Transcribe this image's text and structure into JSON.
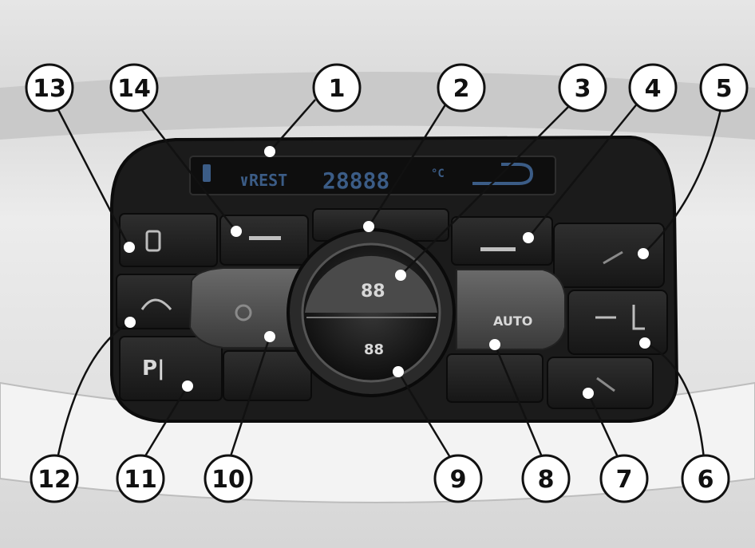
{
  "display": {
    "mode_text": "∨REST",
    "temp_text": "28888",
    "unit_text": "°C"
  },
  "buttons": {
    "parking": "P|",
    "auto": "AUTO",
    "upper_digits": "88",
    "lower_digits": "88"
  },
  "callouts": [
    "1",
    "2",
    "3",
    "4",
    "5",
    "6",
    "7",
    "8",
    "9",
    "10",
    "11",
    "12",
    "13",
    "14"
  ]
}
